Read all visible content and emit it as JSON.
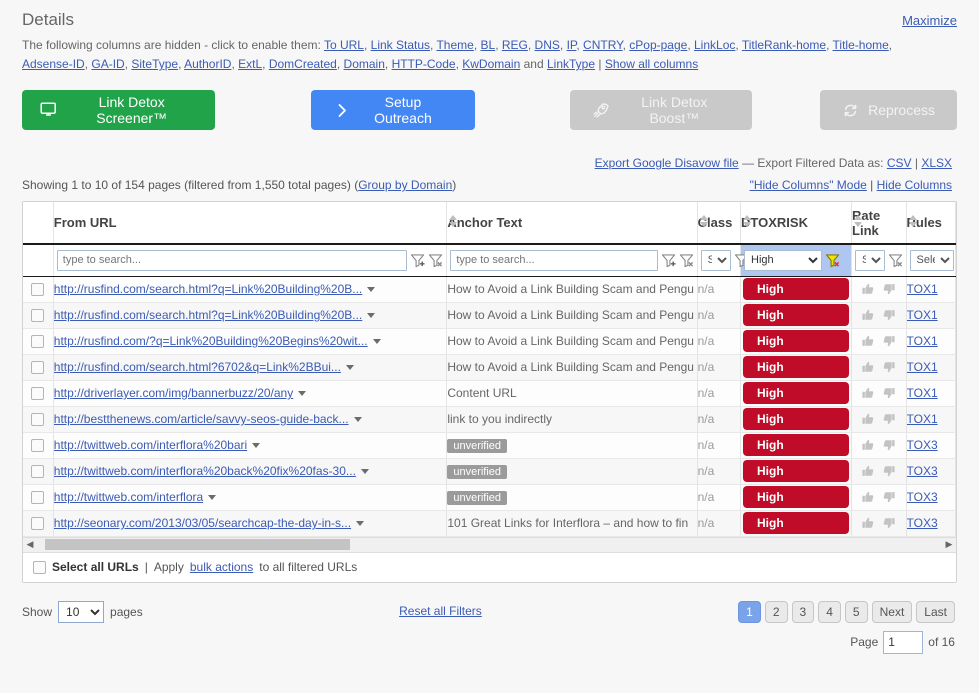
{
  "header": {
    "title": "Details",
    "maximize_label": "Maximize",
    "hidden_cols_prefix": "The following columns are hidden - click to enable them:",
    "hidden_cols": [
      "To URL",
      "Link Status",
      "Theme",
      "BL",
      "REG",
      "DNS",
      "IP",
      "CNTRY",
      "cPop-page",
      "LinkLoc",
      "TitleRank-home",
      "Title-home",
      "Adsense-ID",
      "GA-ID",
      "SiteType",
      "AuthorID",
      "ExtL",
      "DomCreated",
      "Domain",
      "HTTP-Code",
      "KwDomain"
    ],
    "hidden_cols_and": "and",
    "hidden_cols_last": "LinkType",
    "hidden_cols_sep": "|",
    "show_all_columns": "Show all columns"
  },
  "buttons": {
    "screener": {
      "label": "Link Detox Screener™",
      "icon": "monitor-icon",
      "color": "#21a34a"
    },
    "outreach": {
      "label": "Setup Outreach",
      "icon": "chevron-right-icon",
      "color": "#4387f4"
    },
    "boost": {
      "label": "Link Detox Boost™",
      "icon": "rocket-icon",
      "color": "#c9c9c9"
    },
    "reprocess": {
      "label": "Reprocess",
      "icon": "refresh-icon",
      "color": "#c9c9c9"
    }
  },
  "export": {
    "disavow_link": "Export Google Disavow file",
    "dash": "—",
    "filtered_label": "Export Filtered Data as:",
    "csv": "CSV",
    "pipe": "|",
    "xlsx": "XLSX"
  },
  "showing": {
    "text": "Showing 1 to 10 of 154 pages (filtered from 1,550 total pages) (",
    "group_by_domain": "Group by Domain",
    "text_close": ")",
    "hide_columns_mode": "\"Hide Columns\" Mode",
    "pipe": "|",
    "hide_columns": "Hide Columns"
  },
  "table": {
    "columns": [
      {
        "key": "from_url",
        "label": "From URL"
      },
      {
        "key": "anchor_text",
        "label": "Anchor Text"
      },
      {
        "key": "class",
        "label": "Class"
      },
      {
        "key": "dtoxrisk",
        "label": "DTOXRISK"
      },
      {
        "key": "rate_link",
        "label": "Rate Link"
      },
      {
        "key": "rules",
        "label": "Rules"
      }
    ],
    "filters": {
      "from_url_placeholder": "type to search...",
      "anchor_placeholder": "type to search...",
      "class_value": "Se",
      "dtoxrisk_value": "High",
      "rate_value": "Se",
      "rules_value": "Select",
      "dtoxrisk_active": true
    },
    "rows": [
      {
        "url": "http://rusfind.com/search.html?q=Link%20Building%20B...",
        "anchor": "How to Avoid a Link Building Scam and Pengu",
        "anchor_badge": false,
        "class": "n/a",
        "risk": "High",
        "rules": "TOX1"
      },
      {
        "url": "http://rusfind.com/search.html?q=Link%20Building%20B...",
        "anchor": "How to Avoid a Link Building Scam and Pengu",
        "anchor_badge": false,
        "class": "n/a",
        "risk": "High",
        "rules": "TOX1"
      },
      {
        "url": "http://rusfind.com/?q=Link%20Building%20Begins%20wit...",
        "anchor": "How to Avoid a Link Building Scam and Pengu",
        "anchor_badge": false,
        "class": "n/a",
        "risk": "High",
        "rules": "TOX1"
      },
      {
        "url": "http://rusfind.com/search.html?6702&q=Link%2BBui...",
        "anchor": "How to Avoid a Link Building Scam and Pengu",
        "anchor_badge": false,
        "class": "n/a",
        "risk": "High",
        "rules": "TOX1"
      },
      {
        "url": "http://driverlayer.com/img/bannerbuzz/20/any",
        "anchor": "Content URL",
        "anchor_badge": false,
        "class": "n/a",
        "risk": "High",
        "rules": "TOX1"
      },
      {
        "url": "http://bestthenews.com/article/savvy-seos-guide-back...",
        "anchor": "link to you indirectly",
        "anchor_badge": false,
        "class": "n/a",
        "risk": "High",
        "rules": "TOX1"
      },
      {
        "url": "http://twittweb.com/interflora%20bari",
        "anchor": "unverified",
        "anchor_badge": true,
        "class": "n/a",
        "risk": "High",
        "rules": "TOX3"
      },
      {
        "url": "http://twittweb.com/interflora%20back%20fix%20fas-30...",
        "anchor": "unverified",
        "anchor_badge": true,
        "class": "n/a",
        "risk": "High",
        "rules": "TOX3"
      },
      {
        "url": "http://twittweb.com/interflora",
        "anchor": "unverified",
        "anchor_badge": true,
        "class": "n/a",
        "risk": "High",
        "rules": "TOX3"
      },
      {
        "url": "http://seonary.com/2013/03/05/searchcap-the-day-in-s...",
        "anchor": "101 Great Links for Interflora – and how to fin",
        "anchor_badge": false,
        "class": "n/a",
        "risk": "High",
        "rules": "TOX3"
      }
    ],
    "select_all": {
      "label": "Select all URLs",
      "pipe": "|",
      "apply": "Apply",
      "bulk_actions": "bulk actions",
      "suffix": "to all filtered URLs"
    }
  },
  "footer": {
    "show_label": "Show",
    "show_value": "10",
    "pages_label": "pages",
    "reset_filters": "Reset all Filters",
    "pages": [
      "1",
      "2",
      "3",
      "4",
      "5"
    ],
    "active_page": "1",
    "next_label": "Next",
    "last_label": "Last",
    "page_label": "Page",
    "page_value": "1",
    "of_label": "of 16"
  },
  "colors": {
    "risk_high": "#c00c28",
    "accent_blue": "#4387f4",
    "accent_green": "#21a34a",
    "filter_highlight": "#aec6f0"
  }
}
